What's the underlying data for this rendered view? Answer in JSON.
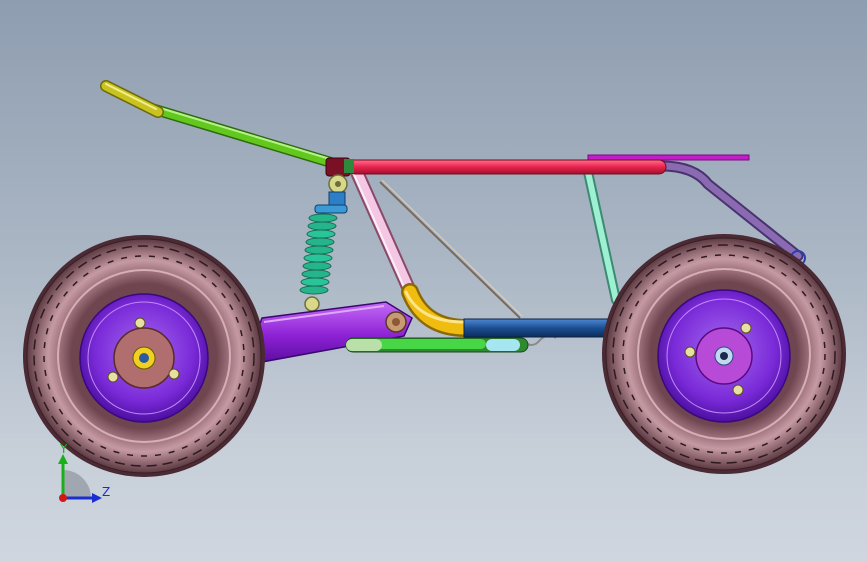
{
  "view": {
    "background_top": "#8e9db0",
    "background_bottom": "#cfd6df"
  },
  "triad": {
    "y_label": "Y",
    "z_label": "Z",
    "y_color": "#19b019",
    "z_color": "#1a2fd1",
    "x_color": "#d01818"
  },
  "parts": {
    "tire_color": "#8a5a63",
    "rim_color": "#7a2ad8",
    "hub_color": "#b06e6e",
    "main_rail_color": "#e8234e",
    "handlebar_color": "#62c81e",
    "grip_color": "#c8c320",
    "seat_strut_color": "#9ef0d2",
    "front_tube_color": "#f4c8e4",
    "bend_color": "#f0bc10",
    "lower_tube_color": "#1b4f92",
    "swingarm_color": "#8e22d6",
    "spring_color": "#25b48c",
    "shock_body_color": "#2c7fc6",
    "rear_hoop_color": "#8a6ab0",
    "rack_color": "#c21ec8",
    "footrest_color": "#46d646"
  }
}
